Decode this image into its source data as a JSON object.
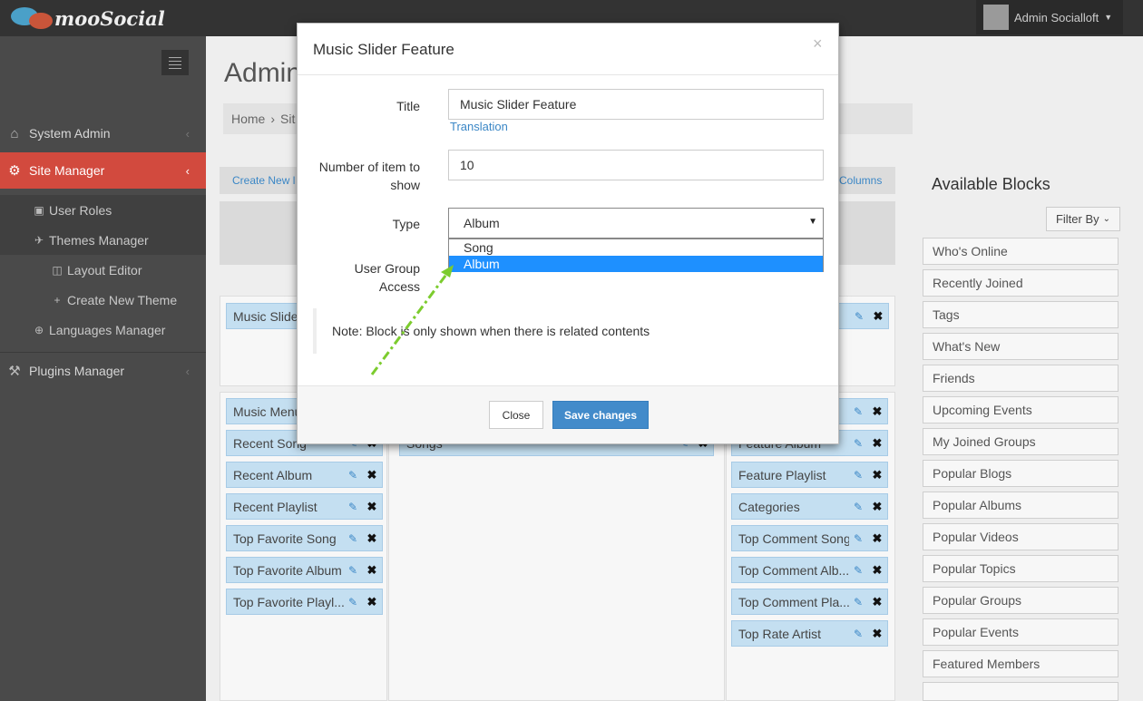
{
  "app": {
    "logo_text": "mooSocial",
    "user_name": "Admin Socialloft"
  },
  "sidebar": {
    "items": [
      {
        "label": "System Admin",
        "icon": "home-icon"
      },
      {
        "label": "Site Manager",
        "icon": "gears-icon"
      },
      {
        "label": "User Roles",
        "icon": "briefcase-icon"
      },
      {
        "label": "Themes Manager",
        "icon": "rocket-icon"
      },
      {
        "label": "Layout Editor",
        "icon": "layout-icon"
      },
      {
        "label": "Create New Theme",
        "icon": "plus-icon"
      },
      {
        "label": "Languages Manager",
        "icon": "globe-icon"
      },
      {
        "label": "Plugins Manager",
        "icon": "plugin-icon"
      }
    ]
  },
  "main": {
    "title": "Admin",
    "breadcrumb_home": "Home",
    "breadcrumb_sep": "›",
    "breadcrumb_current": "Sit",
    "create_new": "Create New l",
    "columns": "Columns",
    "left_col_blocks": [
      "Music Menu",
      "Recent Song",
      "Recent Album",
      "Recent Playlist",
      "Top Favorite Song",
      "Top Favorite Album",
      "Top Favorite Playl..."
    ],
    "top_left_block": "Music Slider",
    "middle_block": "Songs",
    "right_col_blocks": [
      "Feature Album",
      "Feature Playlist",
      "Categories",
      "Top Comment Song",
      "Top Comment Alb...",
      "Top Comment Pla...",
      "Top Rate Artist"
    ]
  },
  "available": {
    "title": "Available Blocks",
    "filter_label": "Filter By",
    "items": [
      "Who's Online",
      "Recently Joined",
      "Tags",
      "What's New",
      "Friends",
      "Upcoming Events",
      "My Joined Groups",
      "Popular Blogs",
      "Popular Albums",
      "Popular Videos",
      "Popular Topics",
      "Popular Groups",
      "Popular Events",
      "Featured Members"
    ]
  },
  "modal": {
    "title": "Music Slider Feature",
    "close_glyph": "×",
    "title_label": "Title",
    "title_value": "Music Slider Feature",
    "translation_link": "Translation",
    "count_label_1": "Number of item to",
    "count_label_2": "show",
    "count_value": "10",
    "type_label": "Type",
    "type_value": "Album",
    "type_options": [
      "Song",
      "Album"
    ],
    "group_label_1": "User Group",
    "group_label_2": "Access",
    "note": "Note: Block is only shown when there is related contents",
    "close_button": "Close",
    "save_button": "Save changes"
  },
  "colors": {
    "accent": "#d24a3e",
    "primary": "#428bca",
    "chip": "#c4dff1",
    "arrow": "#7ccc2e"
  }
}
